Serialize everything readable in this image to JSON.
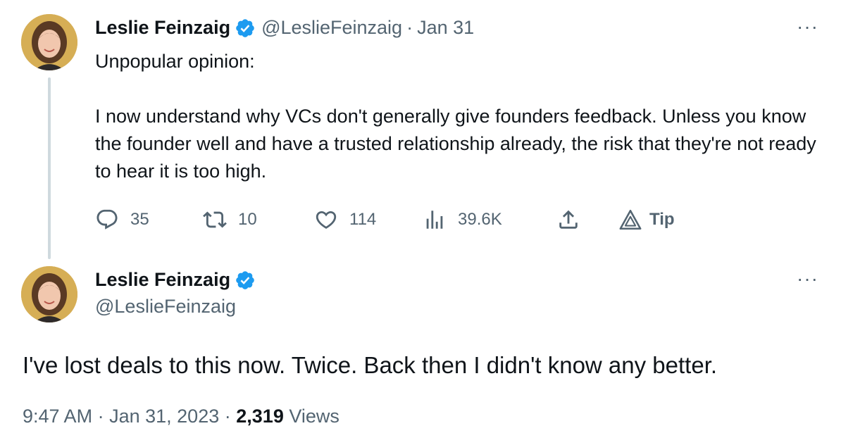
{
  "colors": {
    "text": "#0f1419",
    "secondary": "#536471",
    "verified": "#1d9bf0",
    "thread_line": "#cfd9de"
  },
  "parent_tweet": {
    "author_name": "Leslie Feinzaig",
    "verified": true,
    "handle": "@LeslieFeinzaig",
    "separator": "·",
    "date": "Jan 31",
    "more_label": "···",
    "text_lines": [
      "Unpopular opinion:",
      "I now understand why VCs don't generally give founders feedback. Unless you know the founder well and have a trusted relationship already, the risk that they're not ready to hear it is too high."
    ],
    "actions": {
      "reply": {
        "icon": "reply-icon",
        "count": "35"
      },
      "retweet": {
        "icon": "retweet-icon",
        "count": "10"
      },
      "like": {
        "icon": "heart-icon",
        "count": "114"
      },
      "views": {
        "icon": "views-icon",
        "count": "39.6K"
      },
      "share": {
        "icon": "share-icon"
      },
      "tip": {
        "icon": "tip-icon",
        "label": "Tip"
      }
    }
  },
  "main_tweet": {
    "author_name": "Leslie Feinzaig",
    "verified": true,
    "handle": "@LeslieFeinzaig",
    "more_label": "···",
    "text": "I've lost deals to this now. Twice. Back then I didn't know any better.",
    "time": "9:47 AM",
    "separator": "·",
    "date": "Jan 31, 2023",
    "separator2": "·",
    "views_count": "2,319",
    "views_label": "Views"
  }
}
